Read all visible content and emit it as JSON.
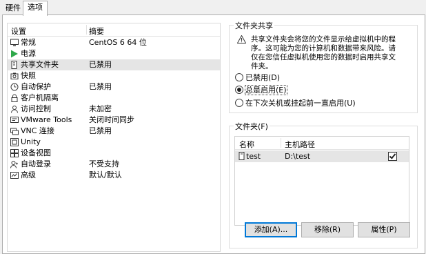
{
  "tabs": [
    {
      "label": "硬件",
      "active": false
    },
    {
      "label": "选项",
      "active": true
    }
  ],
  "settings_list": {
    "col_setting": "设置",
    "col_summary": "摘要",
    "items": [
      {
        "icon": "monitor-icon",
        "name": "常规",
        "summary": "CentOS 6 64 位"
      },
      {
        "icon": "play-icon",
        "name": "电源",
        "summary": ""
      },
      {
        "icon": "shared-folder-icon",
        "name": "共享文件夹",
        "summary": "已禁用",
        "selected": true
      },
      {
        "icon": "snapshot-icon",
        "name": "快照",
        "summary": ""
      },
      {
        "icon": "autoprotect-icon",
        "name": "自动保护",
        "summary": "已禁用"
      },
      {
        "icon": "lock-icon",
        "name": "客户机隔离",
        "summary": ""
      },
      {
        "icon": "access-control-icon",
        "name": "访问控制",
        "summary": "未加密"
      },
      {
        "icon": "vmware-tools-icon",
        "name": "VMware Tools",
        "summary": "关闭时间同步"
      },
      {
        "icon": "vnc-icon",
        "name": "VNC 连接",
        "summary": "已禁用"
      },
      {
        "icon": "unity-icon",
        "name": "Unity",
        "summary": ""
      },
      {
        "icon": "device-view-icon",
        "name": "设备视图",
        "summary": ""
      },
      {
        "icon": "autologin-icon",
        "name": "自动登录",
        "summary": "不受支持"
      },
      {
        "icon": "advanced-icon",
        "name": "高级",
        "summary": "默认/默认"
      }
    ]
  },
  "sharing": {
    "title": "文件夹共享",
    "warning": "共享文件夹会将您的文件显示给虚拟机中的程序。这可能为您的计算机和数据带来风险。请仅在您信任虚拟机使用您的数据时启用共享文件夹。",
    "options": [
      {
        "label": "已禁用(D)",
        "checked": false
      },
      {
        "label": "总是启用(E)",
        "checked": true
      },
      {
        "label": "在下次关机或挂起前一直启用(U)",
        "checked": false
      }
    ]
  },
  "folders": {
    "title": "文件夹(F)",
    "col_name": "名称",
    "col_path": "主机路径",
    "rows": [
      {
        "name": "test",
        "path": "D:\\test",
        "enabled": true
      }
    ],
    "buttons": {
      "add": "添加(A)...",
      "remove": "移除(R)",
      "properties": "属性(P)"
    }
  }
}
